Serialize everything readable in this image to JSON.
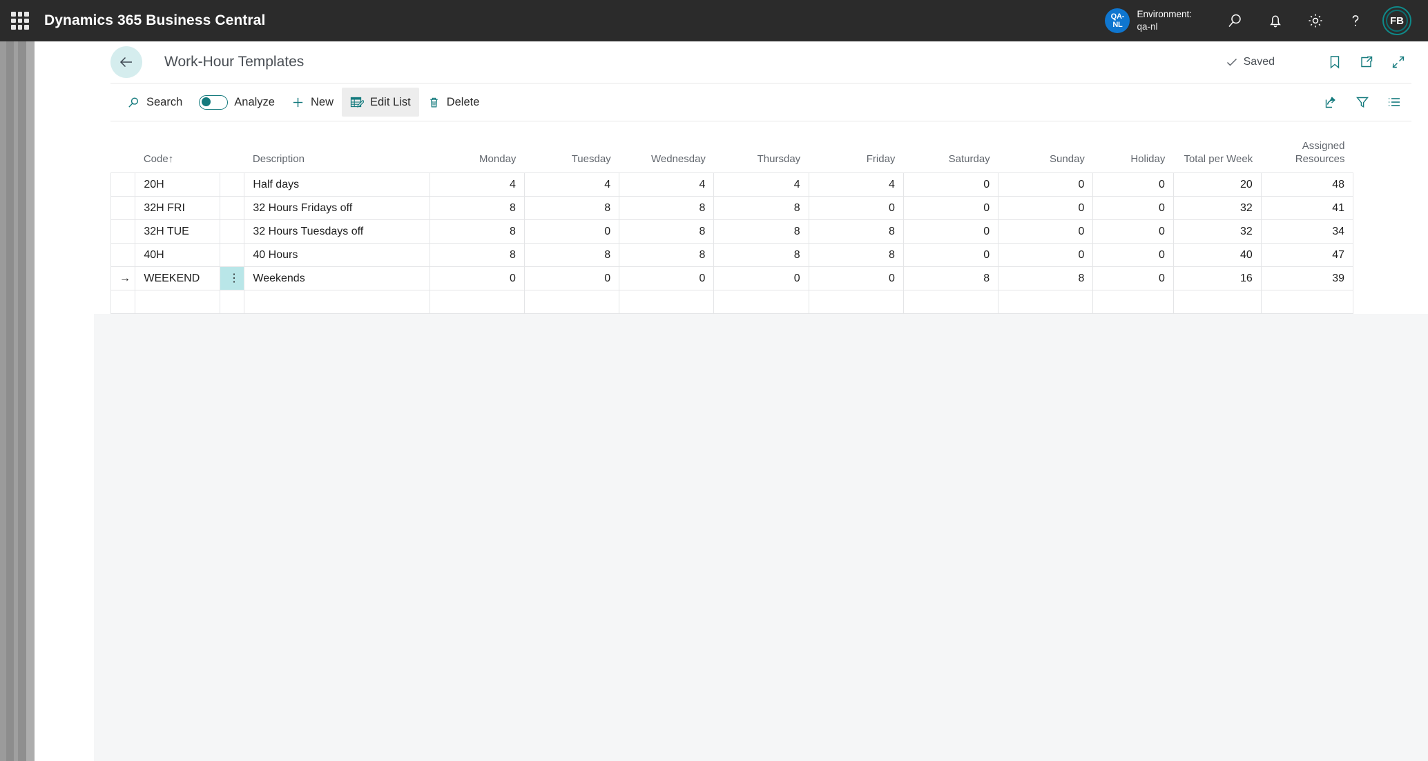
{
  "appbar": {
    "waffle_icon": "app-launcher-icon",
    "title": "Dynamics 365 Business Central",
    "environment": {
      "badge_line1": "QA-",
      "badge_line2": "NL",
      "label": "Environment:",
      "value": "qa-nl"
    },
    "icons": [
      {
        "name": "search-icon"
      },
      {
        "name": "notifications-bell-icon"
      },
      {
        "name": "settings-gear-icon"
      },
      {
        "name": "help-question-icon"
      }
    ],
    "avatar_initials": "FB"
  },
  "page_head": {
    "back_icon": "back-arrow-icon",
    "title": "Work-Hour Templates",
    "saved_label": "Saved",
    "saved_icon": "checkmark-icon",
    "icons": [
      {
        "name": "bookmark-icon"
      },
      {
        "name": "open-in-new-window-icon"
      },
      {
        "name": "collapse-focus-mode-icon"
      }
    ]
  },
  "toolbar": {
    "search_label": "Search",
    "search_icon": "search-icon",
    "analyze_label": "Analyze",
    "analyze_toggle_state": "off",
    "new_label": "New",
    "new_icon": "plus-icon",
    "edit_list_label": "Edit List",
    "edit_list_icon": "edit-list-icon",
    "delete_label": "Delete",
    "delete_icon": "trash-icon",
    "right_icons": [
      {
        "name": "share-icon"
      },
      {
        "name": "filter-funnel-icon"
      },
      {
        "name": "view-options-list-icon"
      }
    ]
  },
  "table": {
    "columns": [
      {
        "key": "code",
        "label": "Code",
        "align": "l",
        "sort": "↑"
      },
      {
        "key": "description",
        "label": "Description",
        "align": "l"
      },
      {
        "key": "monday",
        "label": "Monday",
        "align": "r"
      },
      {
        "key": "tuesday",
        "label": "Tuesday",
        "align": "r"
      },
      {
        "key": "wednesday",
        "label": "Wednesday",
        "align": "r"
      },
      {
        "key": "thursday",
        "label": "Thursday",
        "align": "r"
      },
      {
        "key": "friday",
        "label": "Friday",
        "align": "r"
      },
      {
        "key": "saturday",
        "label": "Saturday",
        "align": "r"
      },
      {
        "key": "sunday",
        "label": "Sunday",
        "align": "r"
      },
      {
        "key": "holiday",
        "label": "Holiday",
        "align": "r"
      },
      {
        "key": "total",
        "label": "Total per Week",
        "align": "r"
      },
      {
        "key": "assigned",
        "label": "Assigned Resources",
        "align": "r"
      }
    ],
    "rows": [
      {
        "selected": false,
        "code": "20H",
        "description": "Half days",
        "monday": "4",
        "tuesday": "4",
        "wednesday": "4",
        "thursday": "4",
        "friday": "4",
        "saturday": "0",
        "sunday": "0",
        "holiday": "0",
        "total": "20",
        "assigned": "48"
      },
      {
        "selected": false,
        "code": "32H FRI",
        "description": "32 Hours Fridays off",
        "monday": "8",
        "tuesday": "8",
        "wednesday": "8",
        "thursday": "8",
        "friday": "0",
        "saturday": "0",
        "sunday": "0",
        "holiday": "0",
        "total": "32",
        "assigned": "41"
      },
      {
        "selected": false,
        "code": "32H TUE",
        "description": "32 Hours Tuesdays off",
        "monday": "8",
        "tuesday": "0",
        "wednesday": "8",
        "thursday": "8",
        "friday": "8",
        "saturday": "0",
        "sunday": "0",
        "holiday": "0",
        "total": "32",
        "assigned": "34"
      },
      {
        "selected": false,
        "code": "40H",
        "description": "40 Hours",
        "monday": "8",
        "tuesday": "8",
        "wednesday": "8",
        "thursday": "8",
        "friday": "8",
        "saturday": "0",
        "sunday": "0",
        "holiday": "0",
        "total": "40",
        "assigned": "47"
      },
      {
        "selected": true,
        "code": "WEEKEND",
        "description": "Weekends",
        "monday": "0",
        "tuesday": "0",
        "wednesday": "0",
        "thursday": "0",
        "friday": "0",
        "saturday": "8",
        "sunday": "8",
        "holiday": "0",
        "total": "16",
        "assigned": "39"
      }
    ],
    "selected_row_indicator": "→",
    "row_menu_icon": "vertical-ellipsis-icon"
  },
  "colors": {
    "accent_teal": "#147a7d",
    "appbar_bg": "#2b2b2b",
    "env_badge_blue": "#0f76cf",
    "selected_cell": "#b9e6e8",
    "back_button_bg": "#d5edee"
  }
}
